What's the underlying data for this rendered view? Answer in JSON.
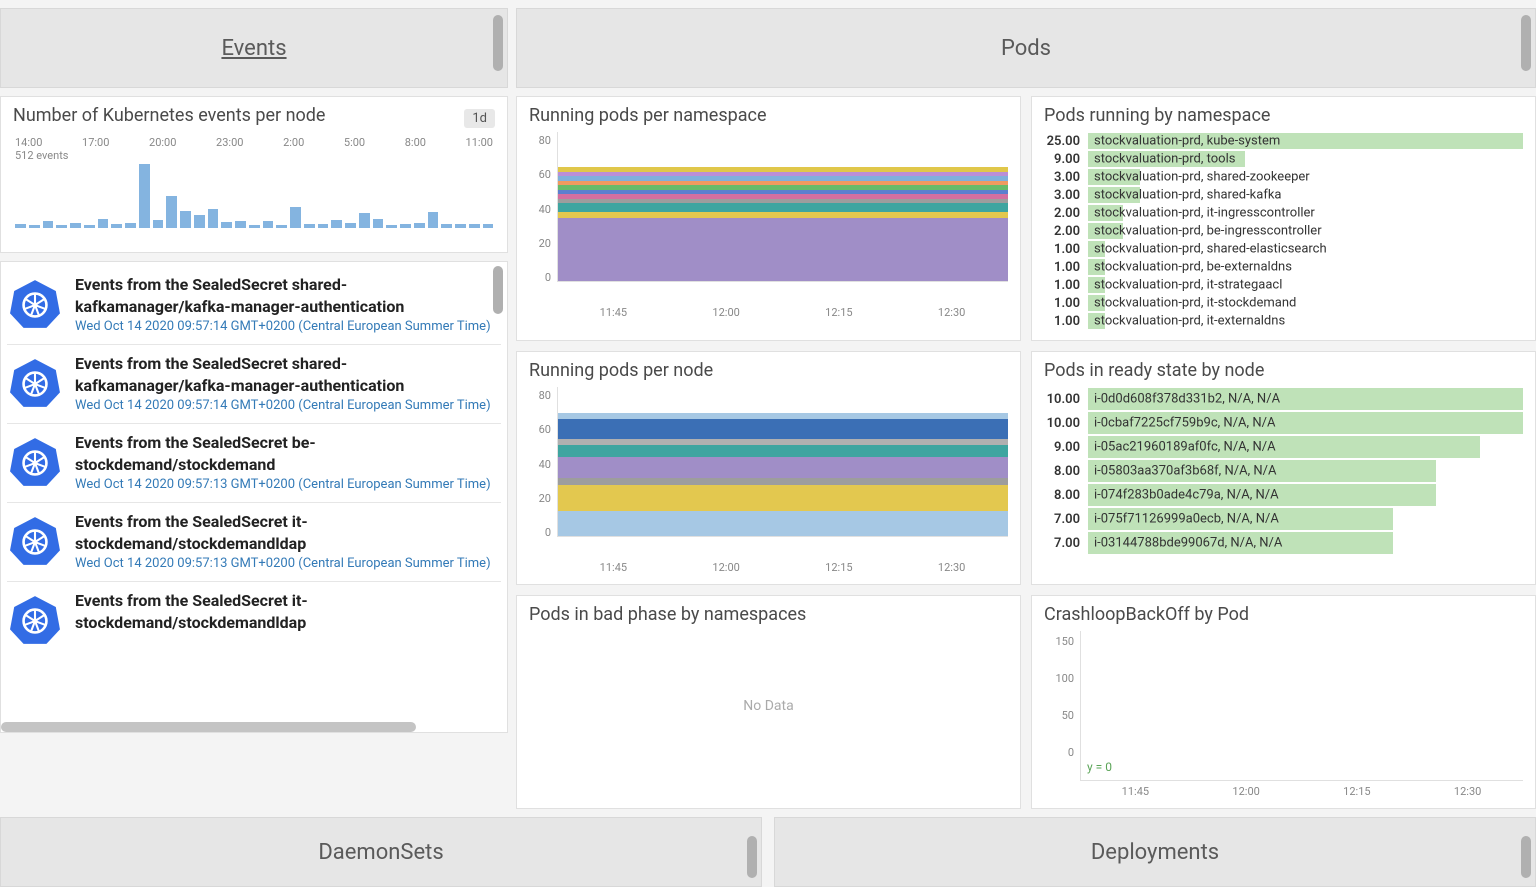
{
  "sections": {
    "events": "Events",
    "pods": "Pods",
    "daemonsets": "DaemonSets",
    "deployments": "Deployments"
  },
  "events_per_node": {
    "title": "Number of Kubernetes events per node",
    "time_range": "1d",
    "sub": "512 events",
    "x_ticks": [
      "14:00",
      "17:00",
      "20:00",
      "23:00",
      "2:00",
      "5:00",
      "8:00",
      "11:00"
    ]
  },
  "chart_data": [
    {
      "id": "events_per_node",
      "type": "bar",
      "title": "Number of Kubernetes events per node",
      "xlabel": "",
      "ylabel": "",
      "categories_note": "hourly buckets 14:00–11:00 next day",
      "values": [
        6,
        4,
        10,
        4,
        8,
        5,
        14,
        6,
        8,
        96,
        12,
        48,
        26,
        20,
        28,
        9,
        11,
        5,
        10,
        4,
        32,
        6,
        6,
        12,
        8,
        22,
        14,
        5,
        6,
        8,
        24,
        6,
        6,
        6,
        6
      ]
    },
    {
      "id": "running_pods_per_namespace",
      "type": "area",
      "title": "Running pods per namespace",
      "xlabel": "",
      "ylabel": "",
      "ylim": [
        0,
        80
      ],
      "x": [
        "11:45",
        "12:00",
        "12:15",
        "12:30"
      ],
      "series": [
        {
          "name": "kube-system",
          "values": [
            25,
            25,
            25,
            25
          ]
        },
        {
          "name": "tools",
          "values": [
            9,
            9,
            9,
            9
          ]
        },
        {
          "name": "shared-zookeeper",
          "values": [
            3,
            3,
            3,
            3
          ]
        },
        {
          "name": "shared-kafka",
          "values": [
            3,
            3,
            3,
            3
          ]
        },
        {
          "name": "it-ingresscontroller",
          "values": [
            2,
            2,
            2,
            2
          ]
        },
        {
          "name": "be-ingresscontroller",
          "values": [
            2,
            2,
            2,
            2
          ]
        },
        {
          "name": "shared-elasticsearch",
          "values": [
            1,
            1,
            1,
            1
          ]
        },
        {
          "name": "be-externaldns",
          "values": [
            1,
            1,
            1,
            1
          ]
        },
        {
          "name": "it-strategaacl",
          "values": [
            1,
            1,
            1,
            1
          ]
        },
        {
          "name": "it-stockdemand",
          "values": [
            1,
            1,
            1,
            1
          ]
        },
        {
          "name": "it-externaldns",
          "values": [
            1,
            1,
            1,
            1
          ]
        }
      ]
    },
    {
      "id": "running_pods_per_node",
      "type": "area",
      "title": "Running pods per node",
      "xlabel": "",
      "ylabel": "",
      "ylim": [
        0,
        80
      ],
      "x": [
        "11:45",
        "12:00",
        "12:15",
        "12:30"
      ],
      "series": [
        {
          "name": "i-0d0d608f378d331b2",
          "values": [
            10,
            10,
            10,
            10
          ]
        },
        {
          "name": "i-0cbaf7225cf759b9c",
          "values": [
            10,
            10,
            10,
            10
          ]
        },
        {
          "name": "i-05ac21960189af0fc",
          "values": [
            9,
            9,
            9,
            9
          ]
        },
        {
          "name": "i-05803aa370af3b68f",
          "values": [
            8,
            8,
            8,
            8
          ]
        },
        {
          "name": "i-074f283b0ade4c79a",
          "values": [
            8,
            8,
            8,
            8
          ]
        },
        {
          "name": "i-075f71126999a0ecb",
          "values": [
            7,
            7,
            7,
            7
          ]
        },
        {
          "name": "i-03144788bde99067d",
          "values": [
            7,
            7,
            7,
            7
          ]
        }
      ]
    },
    {
      "id": "crashloop_by_pod",
      "type": "line",
      "title": "CrashloopBackOff by Pod",
      "xlabel": "",
      "ylabel": "",
      "ylim": [
        0,
        150
      ],
      "x": [
        "11:45",
        "12:00",
        "12:15",
        "12:30"
      ],
      "series": [
        {
          "name": "y = 0",
          "values": [
            0,
            0,
            0,
            0
          ]
        }
      ],
      "annotation": "y = 0"
    }
  ],
  "event_list": [
    {
      "title": "Events from the SealedSecret shared-kafkamanager/kafka-manager-authentication",
      "ts": "Wed Oct 14 2020 09:57:14 GMT+0200 (Central European Summer Time)"
    },
    {
      "title": "Events from the SealedSecret shared-kafkamanager/kafka-manager-authentication",
      "ts": "Wed Oct 14 2020 09:57:14 GMT+0200 (Central European Summer Time)"
    },
    {
      "title": "Events from the SealedSecret be-stockdemand/stockdemand",
      "ts": "Wed Oct 14 2020 09:57:13 GMT+0200 (Central European Summer Time)"
    },
    {
      "title": "Events from the SealedSecret it-stockdemand/stockdemandldap",
      "ts": "Wed Oct 14 2020 09:57:13 GMT+0200 (Central European Summer Time)"
    },
    {
      "title": "Events from the SealedSecret it-stockdemand/stockdemandldap",
      "ts": ""
    }
  ],
  "panels": {
    "running_pods_ns": "Running pods per namespace",
    "running_pods_node": "Running pods per node",
    "pods_bad_phase": "Pods in bad phase by namespaces",
    "pods_by_ns": "Pods running by namespace",
    "pods_ready_node": "Pods in ready state by node",
    "crashloop": "CrashloopBackOff by Pod",
    "no_data": "No Data"
  },
  "time_ticks": [
    "11:45",
    "12:00",
    "12:15",
    "12:30"
  ],
  "stacked_y": [
    "80",
    "60",
    "40",
    "20",
    "0"
  ],
  "crash_y": [
    "150",
    "100",
    "50",
    "0"
  ],
  "crash_annotation": "y = 0",
  "pods_by_namespace": [
    {
      "val": "25.00",
      "label": "stockvaluation-prd, kube-system",
      "pct": 100
    },
    {
      "val": "9.00",
      "label": "stockvaluation-prd, tools",
      "pct": 36
    },
    {
      "val": "3.00",
      "label": "stockvaluation-prd, shared-zookeeper",
      "pct": 12
    },
    {
      "val": "3.00",
      "label": "stockvaluation-prd, shared-kafka",
      "pct": 12
    },
    {
      "val": "2.00",
      "label": "stockvaluation-prd, it-ingresscontroller",
      "pct": 8
    },
    {
      "val": "2.00",
      "label": "stockvaluation-prd, be-ingresscontroller",
      "pct": 8
    },
    {
      "val": "1.00",
      "label": "stockvaluation-prd, shared-elasticsearch",
      "pct": 4
    },
    {
      "val": "1.00",
      "label": "stockvaluation-prd, be-externaldns",
      "pct": 4
    },
    {
      "val": "1.00",
      "label": "stockvaluation-prd, it-strategaacl",
      "pct": 4
    },
    {
      "val": "1.00",
      "label": "stockvaluation-prd, it-stockdemand",
      "pct": 4
    },
    {
      "val": "1.00",
      "label": "stockvaluation-prd, it-externaldns",
      "pct": 4
    }
  ],
  "pods_ready_by_node": [
    {
      "val": "10.00",
      "label": "i-0d0d608f378d331b2, N/A, N/A",
      "pct": 100
    },
    {
      "val": "10.00",
      "label": "i-0cbaf7225cf759b9c, N/A, N/A",
      "pct": 100
    },
    {
      "val": "9.00",
      "label": "i-05ac21960189af0fc, N/A, N/A",
      "pct": 90
    },
    {
      "val": "8.00",
      "label": "i-05803aa370af3b68f, N/A, N/A",
      "pct": 80
    },
    {
      "val": "8.00",
      "label": "i-074f283b0ade4c79a, N/A, N/A",
      "pct": 80
    },
    {
      "val": "7.00",
      "label": "i-075f71126999a0ecb, N/A, N/A",
      "pct": 70
    },
    {
      "val": "7.00",
      "label": "i-03144788bde99067d, N/A, N/A",
      "pct": 70
    }
  ],
  "stacked_ns_bands": [
    {
      "color": "#a08ec7",
      "h": 42,
      "b": 0
    },
    {
      "color": "#e3c84f",
      "h": 4,
      "b": 42
    },
    {
      "color": "#3ea5a0",
      "h": 6,
      "b": 46
    },
    {
      "color": "#9d9d9d",
      "h": 3,
      "b": 52
    },
    {
      "color": "#d36fa0",
      "h": 3,
      "b": 55
    },
    {
      "color": "#5b7fcf",
      "h": 3,
      "b": 58
    },
    {
      "color": "#66bb6a",
      "h": 3,
      "b": 61
    },
    {
      "color": "#ef9a60",
      "h": 3,
      "b": 64
    },
    {
      "color": "#7fb0db",
      "h": 3,
      "b": 67
    },
    {
      "color": "#ba8fd6",
      "h": 3,
      "b": 70
    },
    {
      "color": "#e0c74a",
      "h": 3,
      "b": 73
    }
  ],
  "stacked_node_bands": [
    {
      "color": "#a6c8e4",
      "h": 17,
      "b": 0
    },
    {
      "color": "#e3c84f",
      "h": 17,
      "b": 17
    },
    {
      "color": "#9d9d9d",
      "h": 5,
      "b": 34
    },
    {
      "color": "#a08ec7",
      "h": 14,
      "b": 39
    },
    {
      "color": "#3ea5a0",
      "h": 8,
      "b": 53
    },
    {
      "color": "#b0b0b0",
      "h": 4,
      "b": 61
    },
    {
      "color": "#3b6fb5",
      "h": 13,
      "b": 65
    },
    {
      "color": "#a6c8e4",
      "h": 4,
      "b": 78
    }
  ],
  "mini_bar_heights": [
    6,
    4,
    10,
    4,
    8,
    5,
    14,
    6,
    8,
    96,
    12,
    48,
    26,
    20,
    28,
    9,
    11,
    5,
    10,
    4,
    32,
    6,
    6,
    12,
    8,
    22,
    14,
    5,
    6,
    8,
    24,
    6,
    6,
    6,
    6
  ]
}
